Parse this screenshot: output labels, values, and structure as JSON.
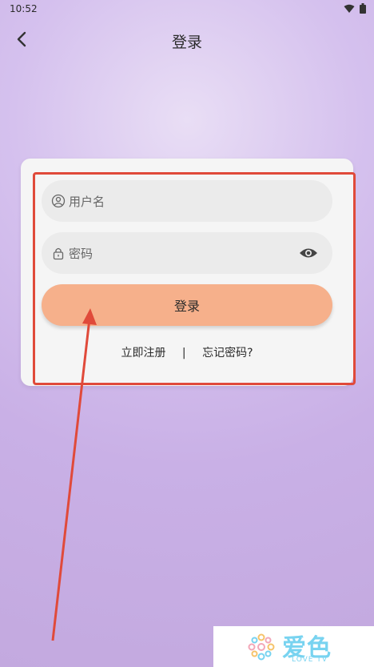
{
  "status": {
    "time": "10:52"
  },
  "header": {
    "title": "登录"
  },
  "form": {
    "username_placeholder": "用户名",
    "password_placeholder": "密码",
    "login_label": "登录"
  },
  "links": {
    "register": "立即注册",
    "separator": "|",
    "forgot": "忘记密码?"
  },
  "watermark": {
    "title": "爱色",
    "subtitle": "LOVE TV"
  },
  "colors": {
    "accent": "#f6b08b",
    "highlight": "#e04a3a",
    "card": "#f5f5f5"
  }
}
